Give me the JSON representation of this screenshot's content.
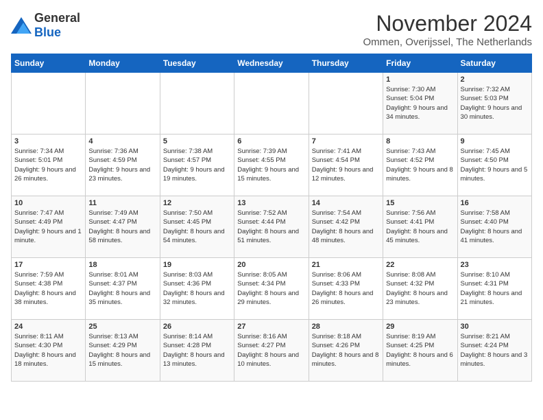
{
  "header": {
    "logo_general": "General",
    "logo_blue": "Blue",
    "month_title": "November 2024",
    "subtitle": "Ommen, Overijssel, The Netherlands"
  },
  "weekdays": [
    "Sunday",
    "Monday",
    "Tuesday",
    "Wednesday",
    "Thursday",
    "Friday",
    "Saturday"
  ],
  "weeks": [
    [
      {
        "day": "",
        "info": ""
      },
      {
        "day": "",
        "info": ""
      },
      {
        "day": "",
        "info": ""
      },
      {
        "day": "",
        "info": ""
      },
      {
        "day": "",
        "info": ""
      },
      {
        "day": "1",
        "info": "Sunrise: 7:30 AM\nSunset: 5:04 PM\nDaylight: 9 hours and 34 minutes."
      },
      {
        "day": "2",
        "info": "Sunrise: 7:32 AM\nSunset: 5:03 PM\nDaylight: 9 hours and 30 minutes."
      }
    ],
    [
      {
        "day": "3",
        "info": "Sunrise: 7:34 AM\nSunset: 5:01 PM\nDaylight: 9 hours and 26 minutes."
      },
      {
        "day": "4",
        "info": "Sunrise: 7:36 AM\nSunset: 4:59 PM\nDaylight: 9 hours and 23 minutes."
      },
      {
        "day": "5",
        "info": "Sunrise: 7:38 AM\nSunset: 4:57 PM\nDaylight: 9 hours and 19 minutes."
      },
      {
        "day": "6",
        "info": "Sunrise: 7:39 AM\nSunset: 4:55 PM\nDaylight: 9 hours and 15 minutes."
      },
      {
        "day": "7",
        "info": "Sunrise: 7:41 AM\nSunset: 4:54 PM\nDaylight: 9 hours and 12 minutes."
      },
      {
        "day": "8",
        "info": "Sunrise: 7:43 AM\nSunset: 4:52 PM\nDaylight: 9 hours and 8 minutes."
      },
      {
        "day": "9",
        "info": "Sunrise: 7:45 AM\nSunset: 4:50 PM\nDaylight: 9 hours and 5 minutes."
      }
    ],
    [
      {
        "day": "10",
        "info": "Sunrise: 7:47 AM\nSunset: 4:49 PM\nDaylight: 9 hours and 1 minute."
      },
      {
        "day": "11",
        "info": "Sunrise: 7:49 AM\nSunset: 4:47 PM\nDaylight: 8 hours and 58 minutes."
      },
      {
        "day": "12",
        "info": "Sunrise: 7:50 AM\nSunset: 4:45 PM\nDaylight: 8 hours and 54 minutes."
      },
      {
        "day": "13",
        "info": "Sunrise: 7:52 AM\nSunset: 4:44 PM\nDaylight: 8 hours and 51 minutes."
      },
      {
        "day": "14",
        "info": "Sunrise: 7:54 AM\nSunset: 4:42 PM\nDaylight: 8 hours and 48 minutes."
      },
      {
        "day": "15",
        "info": "Sunrise: 7:56 AM\nSunset: 4:41 PM\nDaylight: 8 hours and 45 minutes."
      },
      {
        "day": "16",
        "info": "Sunrise: 7:58 AM\nSunset: 4:40 PM\nDaylight: 8 hours and 41 minutes."
      }
    ],
    [
      {
        "day": "17",
        "info": "Sunrise: 7:59 AM\nSunset: 4:38 PM\nDaylight: 8 hours and 38 minutes."
      },
      {
        "day": "18",
        "info": "Sunrise: 8:01 AM\nSunset: 4:37 PM\nDaylight: 8 hours and 35 minutes."
      },
      {
        "day": "19",
        "info": "Sunrise: 8:03 AM\nSunset: 4:36 PM\nDaylight: 8 hours and 32 minutes."
      },
      {
        "day": "20",
        "info": "Sunrise: 8:05 AM\nSunset: 4:34 PM\nDaylight: 8 hours and 29 minutes."
      },
      {
        "day": "21",
        "info": "Sunrise: 8:06 AM\nSunset: 4:33 PM\nDaylight: 8 hours and 26 minutes."
      },
      {
        "day": "22",
        "info": "Sunrise: 8:08 AM\nSunset: 4:32 PM\nDaylight: 8 hours and 23 minutes."
      },
      {
        "day": "23",
        "info": "Sunrise: 8:10 AM\nSunset: 4:31 PM\nDaylight: 8 hours and 21 minutes."
      }
    ],
    [
      {
        "day": "24",
        "info": "Sunrise: 8:11 AM\nSunset: 4:30 PM\nDaylight: 8 hours and 18 minutes."
      },
      {
        "day": "25",
        "info": "Sunrise: 8:13 AM\nSunset: 4:29 PM\nDaylight: 8 hours and 15 minutes."
      },
      {
        "day": "26",
        "info": "Sunrise: 8:14 AM\nSunset: 4:28 PM\nDaylight: 8 hours and 13 minutes."
      },
      {
        "day": "27",
        "info": "Sunrise: 8:16 AM\nSunset: 4:27 PM\nDaylight: 8 hours and 10 minutes."
      },
      {
        "day": "28",
        "info": "Sunrise: 8:18 AM\nSunset: 4:26 PM\nDaylight: 8 hours and 8 minutes."
      },
      {
        "day": "29",
        "info": "Sunrise: 8:19 AM\nSunset: 4:25 PM\nDaylight: 8 hours and 6 minutes."
      },
      {
        "day": "30",
        "info": "Sunrise: 8:21 AM\nSunset: 4:24 PM\nDaylight: 8 hours and 3 minutes."
      }
    ]
  ]
}
